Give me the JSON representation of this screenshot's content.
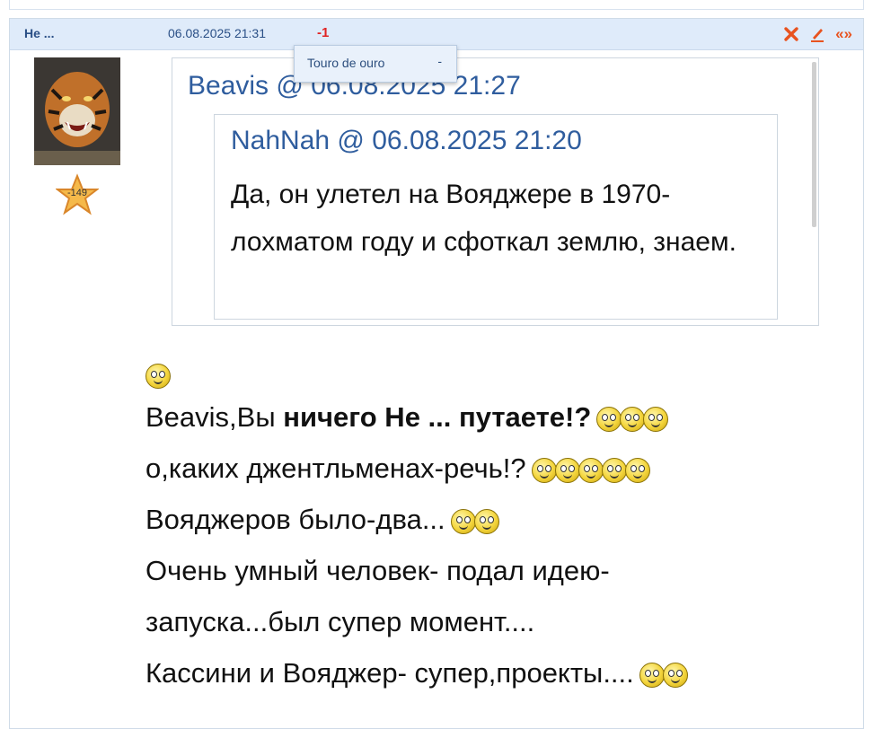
{
  "header": {
    "author": "Не ...",
    "date": "06.08.2025 21:31",
    "rating": "-1",
    "actions": {
      "delete_icon": "close-icon",
      "edit_icon": "pencil-icon",
      "quote_label": "«»"
    }
  },
  "tooltip": {
    "name": "Touro de ouro",
    "value": "-"
  },
  "user": {
    "star_rating": "-149"
  },
  "outer_quote": {
    "author": "Beavis",
    "separator": "@",
    "date": "06.08.2025 21:27"
  },
  "inner_quote": {
    "author": "NahNah",
    "separator": "@",
    "date": "06.08.2025 21:20",
    "text": "Да, он улетел на Вояджере в 1970-лохматом году и сфоткал землю, знаем."
  },
  "message": {
    "line1_prefix": "Beavis,Вы ",
    "line1_bold": "ничего Не ... путаете!?",
    "line2": "о,каких джентльменах-речь!?",
    "line3": "Вояджеров было-два...",
    "line4": "Очень умный человек- подал идею-",
    "line5": "запуска...был супер момент....",
    "line6": "Кассини и Вояджер- супер,проекты...."
  }
}
